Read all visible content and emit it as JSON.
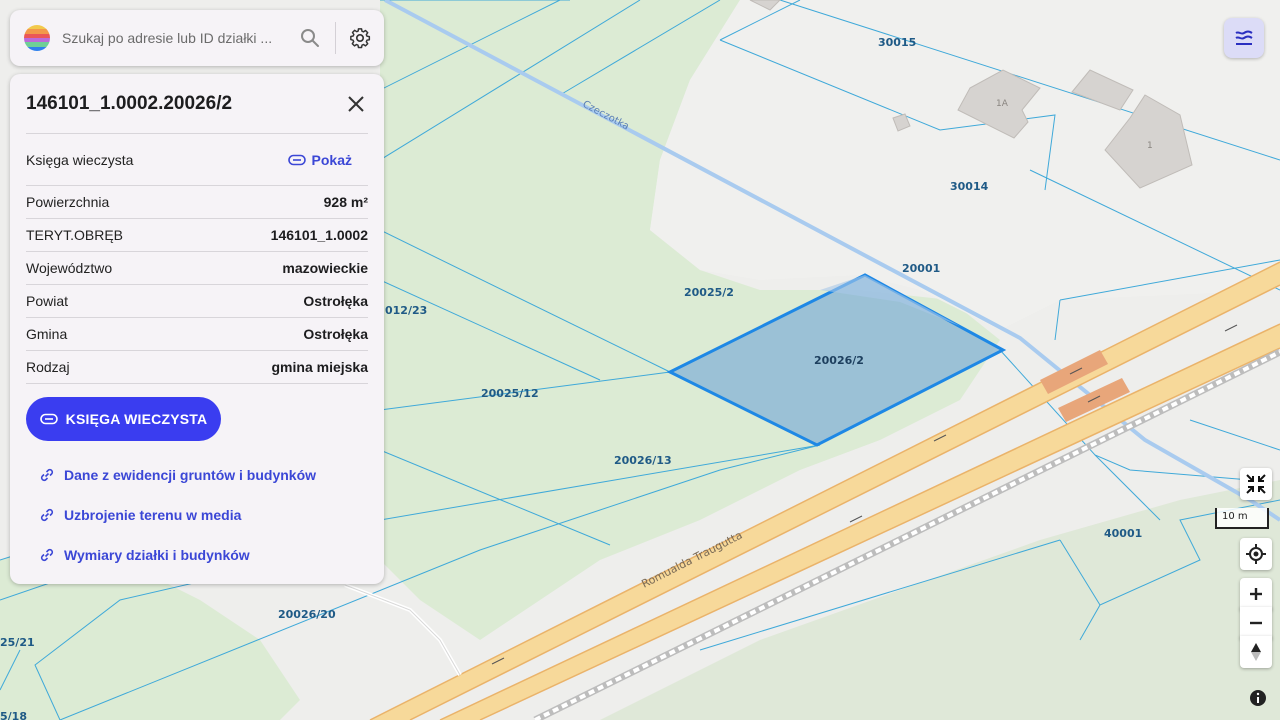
{
  "search": {
    "placeholder": "Szukaj po adresie lub ID działki ..."
  },
  "panel": {
    "title": "146101_1.0002.20026/2",
    "land_registry_label": "Księga wieczysta",
    "land_registry_link": "Pokaż",
    "rows": [
      {
        "label": "Powierzchnia",
        "value": "928 m²"
      },
      {
        "label": "TERYT.OBRĘB",
        "value": "146101_1.0002"
      },
      {
        "label": "Województwo",
        "value": "mazowieckie"
      },
      {
        "label": "Powiat",
        "value": "Ostrołęka"
      },
      {
        "label": "Gmina",
        "value": "Ostrołęka"
      },
      {
        "label": "Rodzaj",
        "value": "gmina miejska"
      }
    ],
    "primary_button": "KSIĘGA WIECZYSTA",
    "links": [
      "Dane z ewidencji gruntów i budynków",
      "Uzbrojenie terenu w media",
      "Wymiary działki i budynków"
    ]
  },
  "map": {
    "parcels": [
      "30015",
      "30014",
      "20001",
      "20025/2",
      "20026/2",
      "012/23",
      "20025/12",
      "20026/13",
      "40001",
      "20026/20",
      "25/21",
      "5/18"
    ],
    "streets": [
      "Czeczotka",
      "Romualda Traugutta"
    ],
    "buildings": [
      "1A",
      "1"
    ],
    "scale_label": "10 m",
    "selected_fill": "#8fbad6",
    "selected_stroke": "#1e88e5",
    "boundary_color": "#3fa9d9",
    "road_color": "#fbe29c",
    "road_edge": "#eab36a"
  },
  "icons": {
    "logo": "rainbow-logo-icon",
    "search": "search-icon",
    "settings": "gear-icon",
    "close": "close-icon",
    "layers": "layers-icon",
    "compress": "compress-arrows-icon",
    "locate": "crosshair-locate-icon",
    "zoom_in": "plus-icon",
    "zoom_out": "minus-icon",
    "compass": "compass-icon",
    "info": "info-icon",
    "link": "link-icon"
  }
}
